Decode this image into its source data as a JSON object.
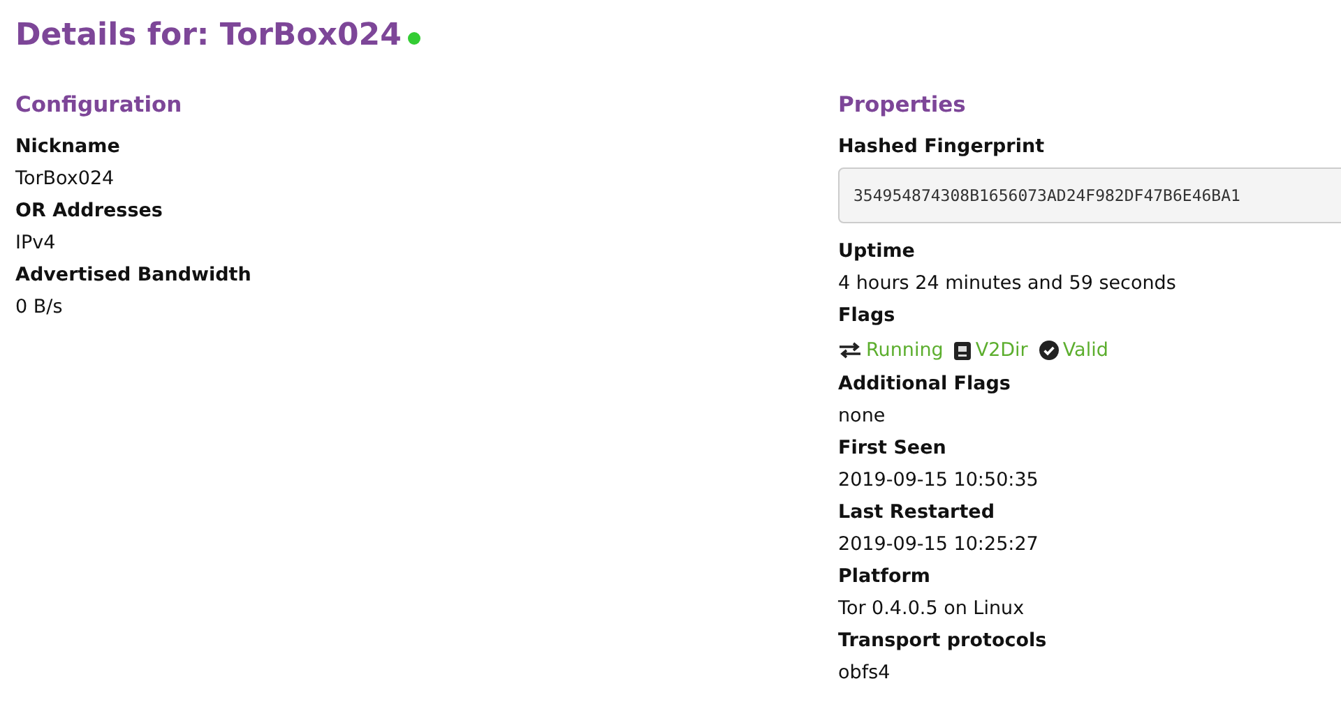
{
  "title": {
    "text": "Details for: TorBox024",
    "online": true
  },
  "configuration": {
    "heading": "Configuration",
    "fields": [
      {
        "label": "Nickname",
        "value": "TorBox024"
      },
      {
        "label": "OR Addresses",
        "value": "IPv4"
      },
      {
        "label": "Advertised Bandwidth",
        "value": "0 B/s"
      }
    ]
  },
  "properties": {
    "heading": "Properties",
    "fingerprint": {
      "label": "Hashed Fingerprint",
      "value": "354954874308B1656073AD24F982DF47B6E46BA1"
    },
    "uptime": {
      "label": "Uptime",
      "value": "4 hours 24 minutes and 59 seconds"
    },
    "flags": {
      "label": "Flags",
      "items": [
        {
          "kind": "running",
          "label": "Running"
        },
        {
          "kind": "v2dir",
          "label": "V2Dir"
        },
        {
          "kind": "valid",
          "label": "Valid"
        }
      ]
    },
    "fields": [
      {
        "label": "Additional Flags",
        "value": "none"
      },
      {
        "label": "First Seen",
        "value": "2019-09-15 10:50:35"
      },
      {
        "label": "Last Restarted",
        "value": "2019-09-15 10:25:27"
      },
      {
        "label": "Platform",
        "value": "Tor 0.4.0.5 on Linux"
      },
      {
        "label": "Transport protocols",
        "value": "obfs4"
      }
    ]
  }
}
